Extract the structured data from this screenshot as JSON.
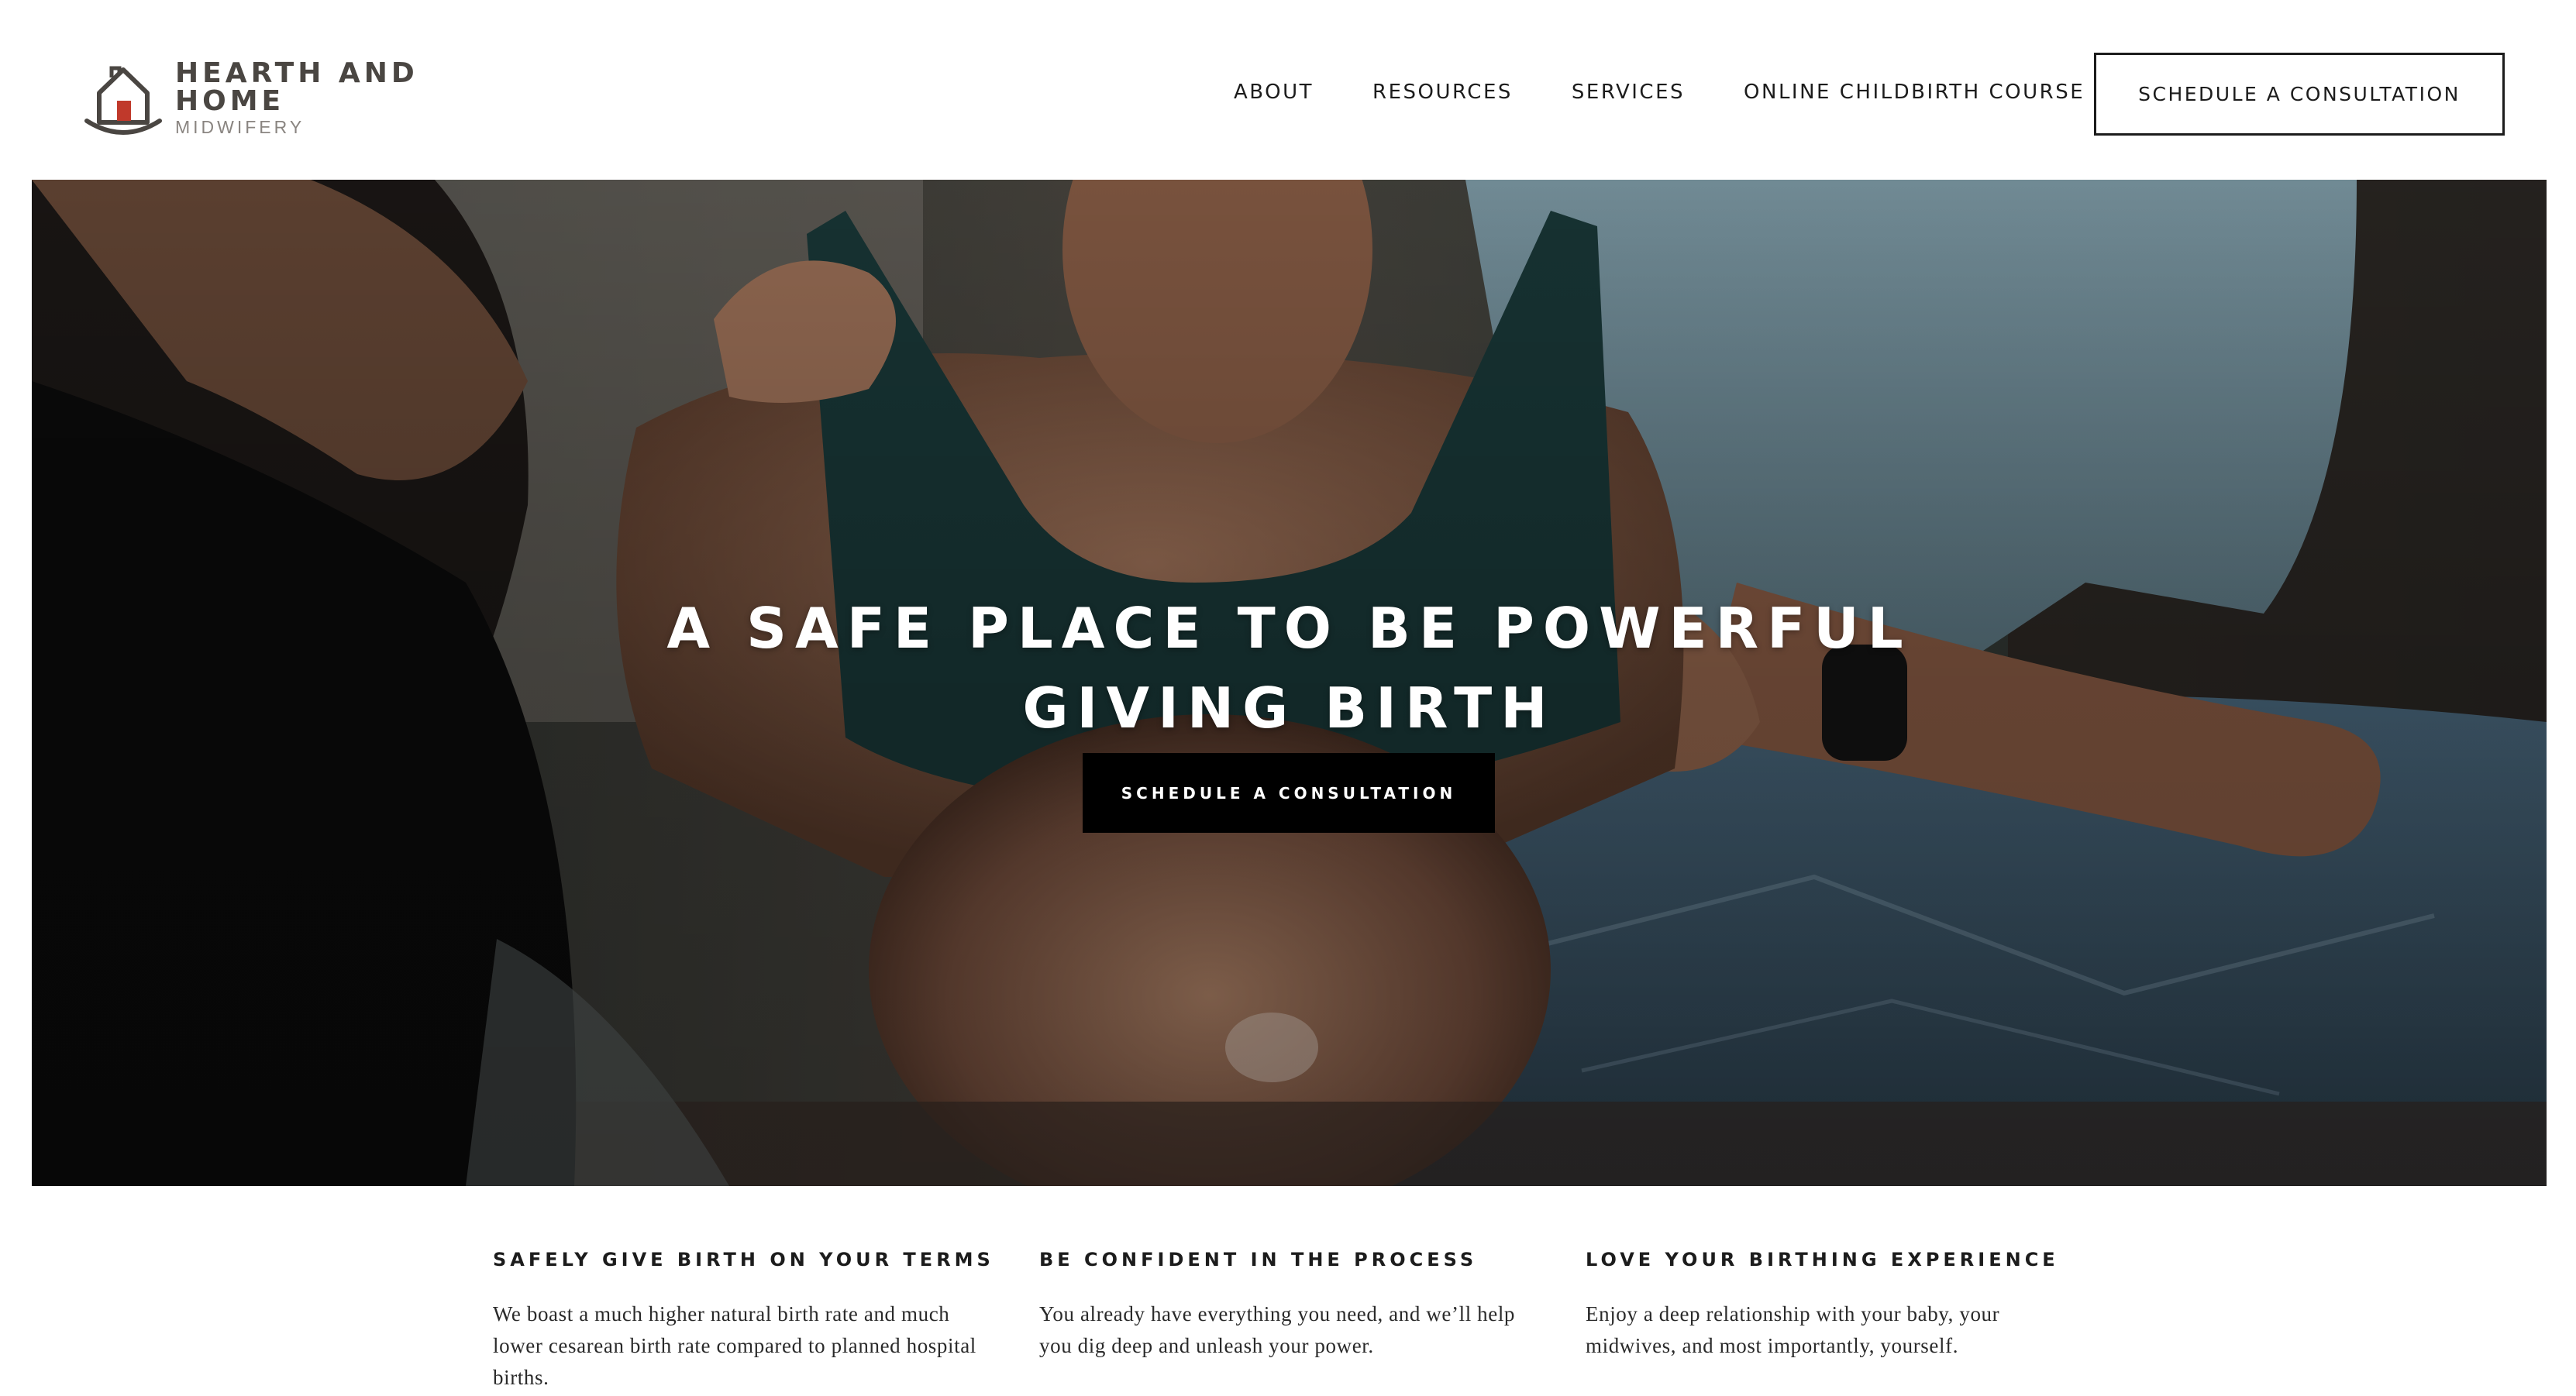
{
  "logo": {
    "title": "HEARTH AND HOME",
    "subtitle": "MIDWIFERY"
  },
  "nav": {
    "items": [
      {
        "label": "ABOUT"
      },
      {
        "label": "RESOURCES"
      },
      {
        "label": "SERVICES"
      },
      {
        "label": "ONLINE CHILDBIRTH COURSE"
      }
    ],
    "cta_label": "SCHEDULE A CONSULTATION"
  },
  "hero": {
    "title": "A SAFE PLACE TO BE POWERFUL GIVING BIRTH",
    "cta_label": "SCHEDULE A CONSULTATION"
  },
  "features": [
    {
      "title": "SAFELY GIVE BIRTH ON YOUR TERMS",
      "text": "We boast a much higher natural birth rate and much lower cesarean birth rate compared to planned hospital births."
    },
    {
      "title": "BE CONFIDENT IN THE PROCESS",
      "text": "You already have everything you need, and we’ll help you dig deep and unleash your power."
    },
    {
      "title": "LOVE YOUR BIRTHING EXPERIENCE",
      "text": "Enjoy a deep relationship with your baby, your midwives, and most importantly, yourself."
    }
  ],
  "colors": {
    "logo_text": "#4a4642",
    "logo_accent": "#c0392b",
    "hero_button_bg": "#000000",
    "text": "#1c1c1c"
  }
}
